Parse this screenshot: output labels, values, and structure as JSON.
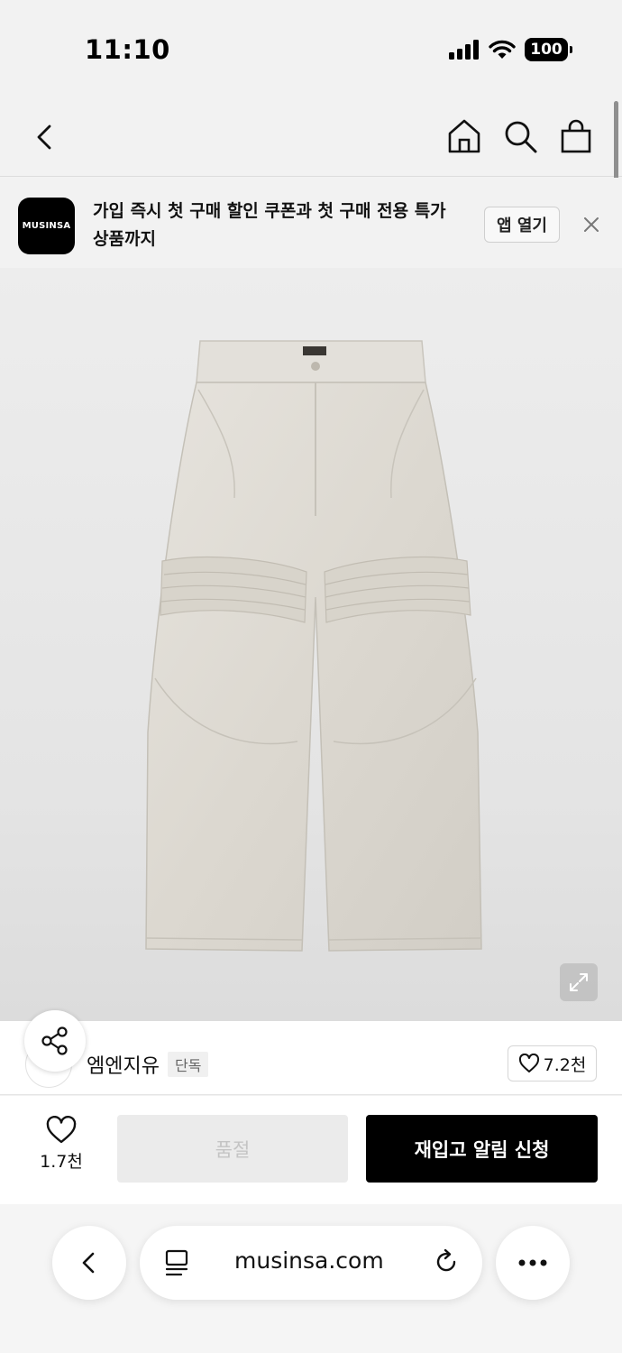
{
  "status_bar": {
    "time": "11:10",
    "battery": "100",
    "icons": [
      "cellular-signal-icon",
      "wifi-icon",
      "battery-icon"
    ]
  },
  "header": {
    "icons": [
      "chevron-left-icon",
      "home-icon",
      "search-icon",
      "shopping-bag-icon"
    ]
  },
  "app_banner": {
    "logo_text": "MUSINSA",
    "message": "가입 즉시 첫 구매 할인 쿠폰과 첫 구매 전용 특가 상품까지",
    "open_app_label": "앱 열기",
    "close_icon": "close-icon"
  },
  "product": {
    "image_alt": "white wide-leg pants with quilted knee panels",
    "expand_icon": "expand-icon"
  },
  "brand": {
    "name": "엠엔지유",
    "badge": "단독",
    "like_count": "7.2천",
    "share_icon": "share-icon"
  },
  "actions": {
    "wish_count": "1.7천",
    "soldout_label": "품절",
    "restock_label": "재입고 알림 신청"
  },
  "browser": {
    "url": "musinsa.com",
    "icons": [
      "back-icon",
      "reader-icon",
      "reload-icon",
      "more-icon"
    ]
  },
  "colors": {
    "accent": "#000000",
    "background": "#f2f2f2",
    "disabled_button": "#ebebeb",
    "disabled_text": "#c4c4c4"
  }
}
